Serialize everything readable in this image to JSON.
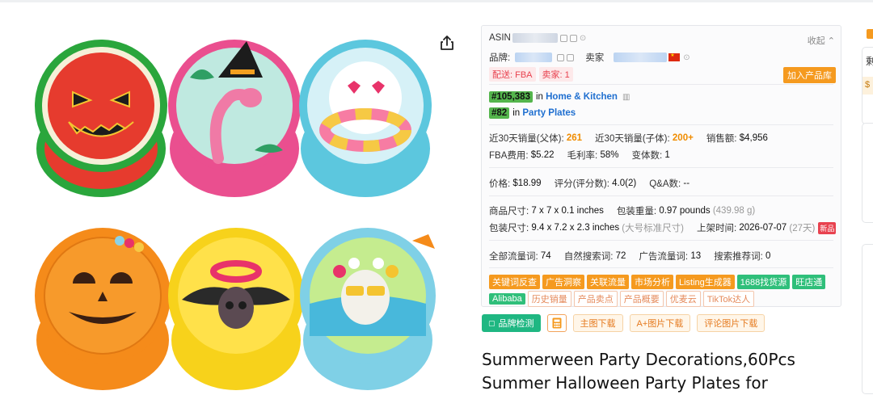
{
  "panel": {
    "asin_label": "ASIN",
    "collapse_label": "收起",
    "brand_label": "品牌:",
    "seller_label": "卖家",
    "delivery_tag": "配送: FBA",
    "seller_count_tag": "卖家: 1",
    "add_to_library": "加入产品库",
    "rank1": {
      "value": "#105,383",
      "in": "in",
      "category": "Home & Kitchen"
    },
    "rank2": {
      "value": "#82",
      "in": "in",
      "category": "Party Plates"
    },
    "sales_parent_label": "近30天销量(父体):",
    "sales_parent_value": "261",
    "sales_child_label": "近30天销量(子体):",
    "sales_child_value": "200+",
    "revenue_label": "销售额:",
    "revenue_value": "$4,956",
    "fba_label": "FBA费用:",
    "fba_value": "$5.22",
    "margin_label": "毛利率:",
    "margin_value": "58%",
    "variants_label": "变体数:",
    "variants_value": "1",
    "price_label": "价格:",
    "price_value": "$18.99",
    "rating_label": "评分(评分数):",
    "rating_value": "4.0(2)",
    "qa_label": "Q&A数:",
    "qa_value": "--",
    "size_label": "商品尺寸:",
    "size_value": "7 x 7 x 0.1 inches",
    "weight_label": "包装重量:",
    "weight_value": "0.97 pounds",
    "weight_grams": "(439.98 g)",
    "pkg_label": "包装尺寸:",
    "pkg_value": "9.4 x 7.2 x 2.3 inches",
    "pkg_class": "(大号标准尺寸)",
    "listed_label": "上架时间:",
    "listed_value": "2026-07-07",
    "listed_days": "(27天)",
    "new_badge": "新品",
    "kw_total_label": "全部流量词:",
    "kw_total_value": "74",
    "kw_organic_label": "自然搜索词:",
    "kw_organic_value": "72",
    "kw_ad_label": "广告流量词:",
    "kw_ad_value": "13",
    "kw_rec_label": "搜索推荐词:",
    "kw_rec_value": "0",
    "tools_row1": [
      {
        "label": "关键词反查",
        "style": "o"
      },
      {
        "label": "广告洞察",
        "style": "o"
      },
      {
        "label": "关联流量",
        "style": "o"
      },
      {
        "label": "市场分析",
        "style": "o"
      },
      {
        "label": "Listing生成器",
        "style": "o"
      },
      {
        "label": "1688找货源",
        "style": "g"
      },
      {
        "label": "旺店通",
        "style": "g"
      }
    ],
    "tools_row2": [
      {
        "label": "Alibaba",
        "style": "g"
      },
      {
        "label": "历史销量",
        "style": "l"
      },
      {
        "label": "产品卖点",
        "style": "l"
      },
      {
        "label": "产品概要",
        "style": "l"
      },
      {
        "label": "优麦云",
        "style": "l"
      },
      {
        "label": "TikTok达人",
        "style": "l"
      }
    ]
  },
  "actions": {
    "brand_check": "品牌检测",
    "main_img_download": "主图下载",
    "aplus_download": "A+图片下载",
    "review_img_download": "评论图片下载"
  },
  "product": {
    "title": "Summerween Party Decorations,60Pcs Summer Halloween Party Plates for"
  },
  "edge": {
    "partial_char": "剩",
    "partial_price": "$"
  },
  "colors": {
    "accent_orange": "#f59a1f",
    "accent_green": "#1fb782",
    "rank_green": "#54b54c",
    "link_blue": "#1f6fd0"
  }
}
